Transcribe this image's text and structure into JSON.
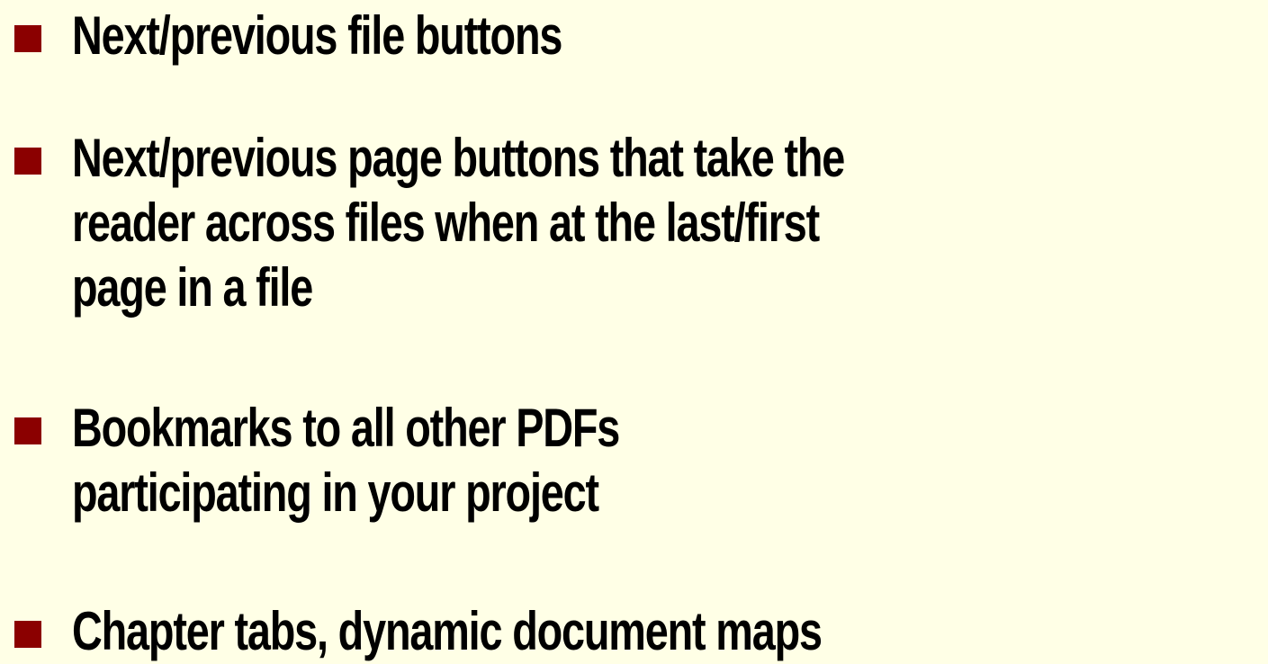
{
  "colors": {
    "background": "#ffffe6",
    "bullet_marker": "#8b0000",
    "text": "#000000"
  },
  "bullets": [
    {
      "marker_icon": "square-bullet-icon",
      "text": "Next/previous file buttons"
    },
    {
      "marker_icon": "square-bullet-icon",
      "text": "Next/previous page buttons that take the\nreader across files when at the last/first\npage in a file"
    },
    {
      "marker_icon": "square-bullet-icon",
      "text": "Bookmarks to all other PDFs\nparticipating in your project"
    },
    {
      "marker_icon": "square-bullet-icon",
      "text": "Chapter tabs, dynamic document maps"
    }
  ]
}
